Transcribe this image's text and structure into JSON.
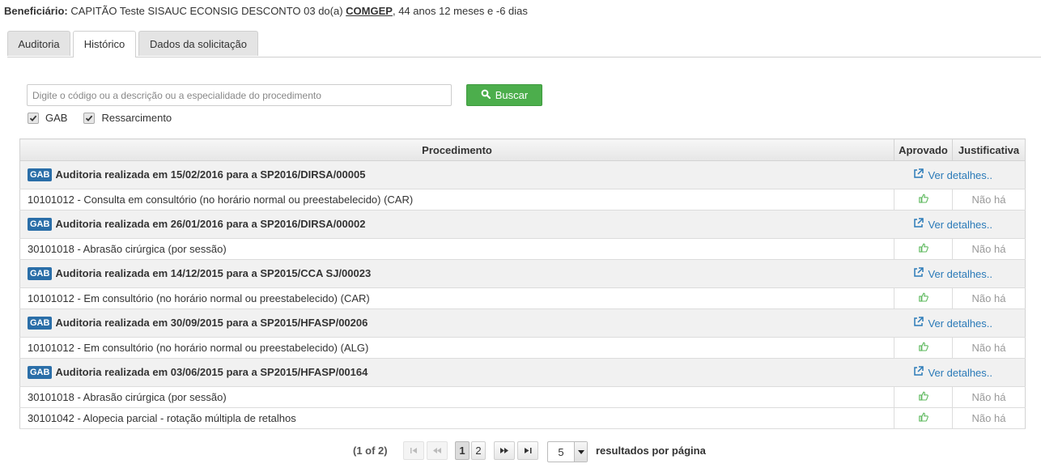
{
  "header": {
    "label": "Beneficiário:",
    "name": "CAPITÃO Teste SISAUC ECONSIG DESCONTO 03 do(a)",
    "org": "COMGEP",
    "age": ", 44 anos 12 meses e -6 dias"
  },
  "tabs": [
    {
      "label": "Auditoria",
      "active": false
    },
    {
      "label": "Histórico",
      "active": true
    },
    {
      "label": "Dados da solicitação",
      "active": false
    }
  ],
  "search": {
    "placeholder": "Digite o código ou a descrição ou a especialidade do procedimento",
    "value": "",
    "button_label": "Buscar"
  },
  "filters": [
    {
      "label": "GAB",
      "checked": true
    },
    {
      "label": "Ressarcimento",
      "checked": true
    }
  ],
  "table": {
    "headers": {
      "procedimento": "Procedimento",
      "aprovado": "Aprovado",
      "justificativa": "Justificativa"
    },
    "details_label": "Ver detalhes..",
    "none_label": "Não há",
    "groups": [
      {
        "badge": "GAB",
        "title": "Auditoria realizada em 15/02/2016 para a SP2016/DIRSA/00005",
        "items": [
          "10101012 - Consulta em consultório (no horário normal ou preestabelecido) (CAR)"
        ]
      },
      {
        "badge": "GAB",
        "title": "Auditoria realizada em 26/01/2016 para a SP2016/DIRSA/00002",
        "items": [
          "30101018 - Abrasão cirúrgica (por sessão)"
        ]
      },
      {
        "badge": "GAB",
        "title": "Auditoria realizada em 14/12/2015 para a SP2015/CCA SJ/00023",
        "items": [
          "10101012 - Em consultório (no horário normal ou preestabelecido) (CAR)"
        ]
      },
      {
        "badge": "GAB",
        "title": "Auditoria realizada em 30/09/2015 para a SP2015/HFASP/00206",
        "items": [
          "10101012 - Em consultório (no horário normal ou preestabelecido) (ALG)"
        ]
      },
      {
        "badge": "GAB",
        "title": "Auditoria realizada em 03/06/2015 para a SP2015/HFASP/00164",
        "items": [
          "30101018 - Abrasão cirúrgica (por sessão)",
          "30101042 - Alopecia parcial - rotação múltipla de retalhos"
        ]
      }
    ]
  },
  "pager": {
    "count": "(1 of 2)",
    "pages": [
      "1",
      "2"
    ],
    "current_page": "1",
    "per_page": "5",
    "per_page_label": "resultados por página"
  },
  "colors": {
    "accent_green": "#4cae4c",
    "badge_blue": "#2a6ea8",
    "link_blue": "#2a7ab8",
    "thumb_green": "#5cb85c"
  },
  "icons": {
    "search": "search-icon",
    "details": "external-link-icon",
    "approved": "thumbs-up-icon"
  }
}
